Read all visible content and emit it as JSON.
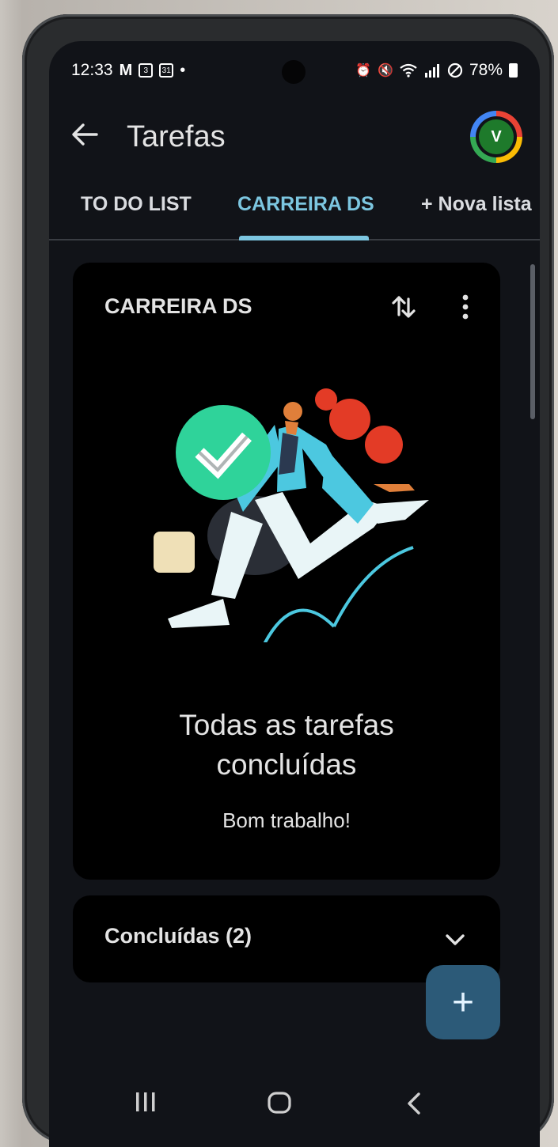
{
  "status_bar": {
    "time": "12:33",
    "gmail_icon": "M",
    "badge_count": "3",
    "calendar_date": "31",
    "battery": "78%"
  },
  "app_bar": {
    "title": "Tarefas",
    "avatar_initial": "V"
  },
  "tabs": [
    {
      "label": "TO DO LIST",
      "active": false
    },
    {
      "label": "CARREIRA DS",
      "active": true
    },
    {
      "label": "+ Nova lista",
      "active": false
    }
  ],
  "list_card": {
    "title": "CARREIRA DS",
    "empty_title_line1": "Todas as tarefas",
    "empty_title_line2": "concluídas",
    "empty_subtitle": "Bom trabalho!"
  },
  "completed_section": {
    "label": "Concluídas (2)"
  },
  "fab": {
    "icon": "+"
  },
  "colors": {
    "accent": "#7cc6e0",
    "fab": "#2c5a78",
    "background": "#111318",
    "card": "#000000"
  }
}
